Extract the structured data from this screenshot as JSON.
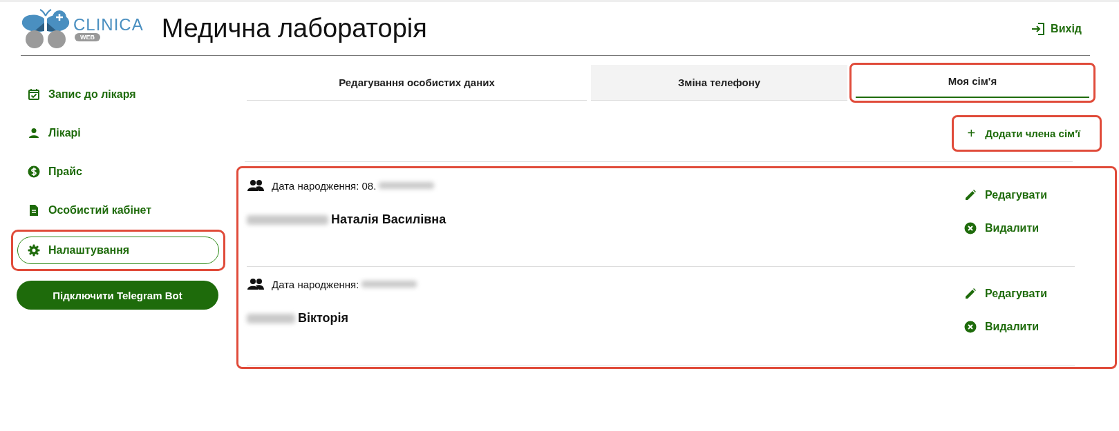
{
  "header": {
    "logo_text": "CLINICA",
    "logo_badge": "WEB",
    "title": "Медична лабораторія",
    "exit": "Вихід"
  },
  "sidebar": {
    "items": [
      {
        "label": "Запис до лікаря",
        "kind": "calendar",
        "selected": false,
        "highlighted": false
      },
      {
        "label": "Лікарі",
        "kind": "person",
        "selected": false,
        "highlighted": false
      },
      {
        "label": "Прайс",
        "kind": "dollar",
        "selected": false,
        "highlighted": false
      },
      {
        "label": "Особистий кабінет",
        "kind": "document",
        "selected": false,
        "highlighted": false
      },
      {
        "label": "Налаштування",
        "kind": "gear",
        "selected": true,
        "highlighted": true
      }
    ],
    "telegram_button": "Підключити Telegram Bot"
  },
  "tabs": [
    {
      "label": "Редагування особистих даних",
      "selected": false,
      "hovered": false,
      "highlighted": false
    },
    {
      "label": "Зміна телефону",
      "selected": false,
      "hovered": true,
      "highlighted": false
    },
    {
      "label": "Моя сім'я",
      "selected": true,
      "hovered": false,
      "highlighted": true
    }
  ],
  "add_member": {
    "icon": "+",
    "label": "Додати члена сім'ї",
    "highlighted": true
  },
  "members_highlighted": true,
  "members": [
    {
      "birth_label": "Дата народження:",
      "birth_value": "08.",
      "date_blurred": true,
      "name": "Наталія Василівна",
      "surname_blurred": true,
      "edit": "Редагувати",
      "delete": "Видалити"
    },
    {
      "birth_label": "Дата народження:",
      "date_blurred": true,
      "name": "Вікторія",
      "surname_blurred": true,
      "edit": "Редагувати",
      "delete": "Видалити"
    }
  ]
}
